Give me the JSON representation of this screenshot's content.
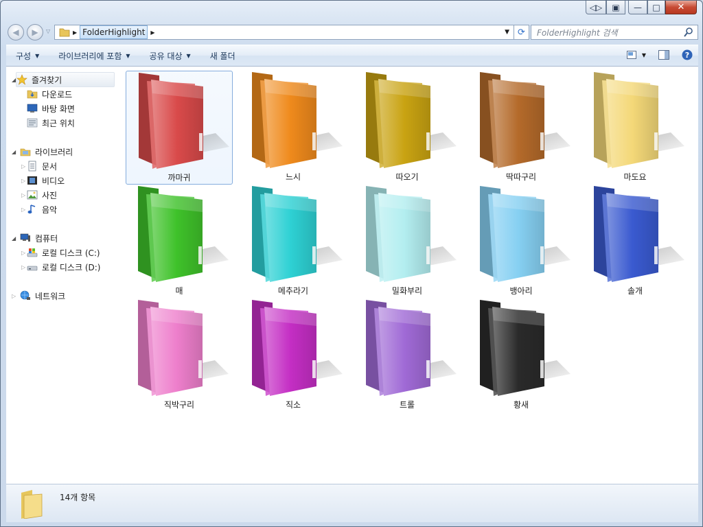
{
  "window": {
    "caption_buttons": [
      "◁▷",
      "▣",
      "—",
      "□",
      "✕"
    ]
  },
  "nav": {
    "back_glyph": "◀",
    "forward_glyph": "▶",
    "breadcrumb": "FolderHighlight",
    "search_placeholder": "FolderHighlight 검색"
  },
  "toolbar": {
    "items": [
      "구성",
      "라이브러리에 포함",
      "공유 대상",
      "새 폴더"
    ]
  },
  "sidebar": {
    "favorites": {
      "label": "즐겨찾기",
      "items": [
        "다운로드",
        "바탕 화면",
        "최근 위치"
      ]
    },
    "libraries": {
      "label": "라이브러리",
      "items": [
        "문서",
        "비디오",
        "사진",
        "음악"
      ]
    },
    "computer": {
      "label": "컴퓨터",
      "items": [
        "로컬 디스크 (C:)",
        "로컬 디스크 (D:)"
      ]
    },
    "network": {
      "label": "네트워크"
    }
  },
  "folders": [
    {
      "name": "까마귀",
      "color": "#d94a4a"
    },
    {
      "name": "느시",
      "color": "#ef8a1c"
    },
    {
      "name": "따오기",
      "color": "#c9a312"
    },
    {
      "name": "딱따구리",
      "color": "#b46a2a"
    },
    {
      "name": "마도요",
      "color": "#f4d878"
    },
    {
      "name": "매",
      "color": "#3fc22a"
    },
    {
      "name": "메추라기",
      "color": "#2ed1d4"
    },
    {
      "name": "밀화부리",
      "color": "#b3eef0"
    },
    {
      "name": "뱅아리",
      "color": "#86d0f2"
    },
    {
      "name": "솔개",
      "color": "#3a5ad0"
    },
    {
      "name": "직박구리",
      "color": "#ee7fcc"
    },
    {
      "name": "직소",
      "color": "#c42ec4"
    },
    {
      "name": "트롤",
      "color": "#a06ad6"
    },
    {
      "name": "황새",
      "color": "#2a2a2a"
    }
  ],
  "status": {
    "count": "14개 항목"
  }
}
